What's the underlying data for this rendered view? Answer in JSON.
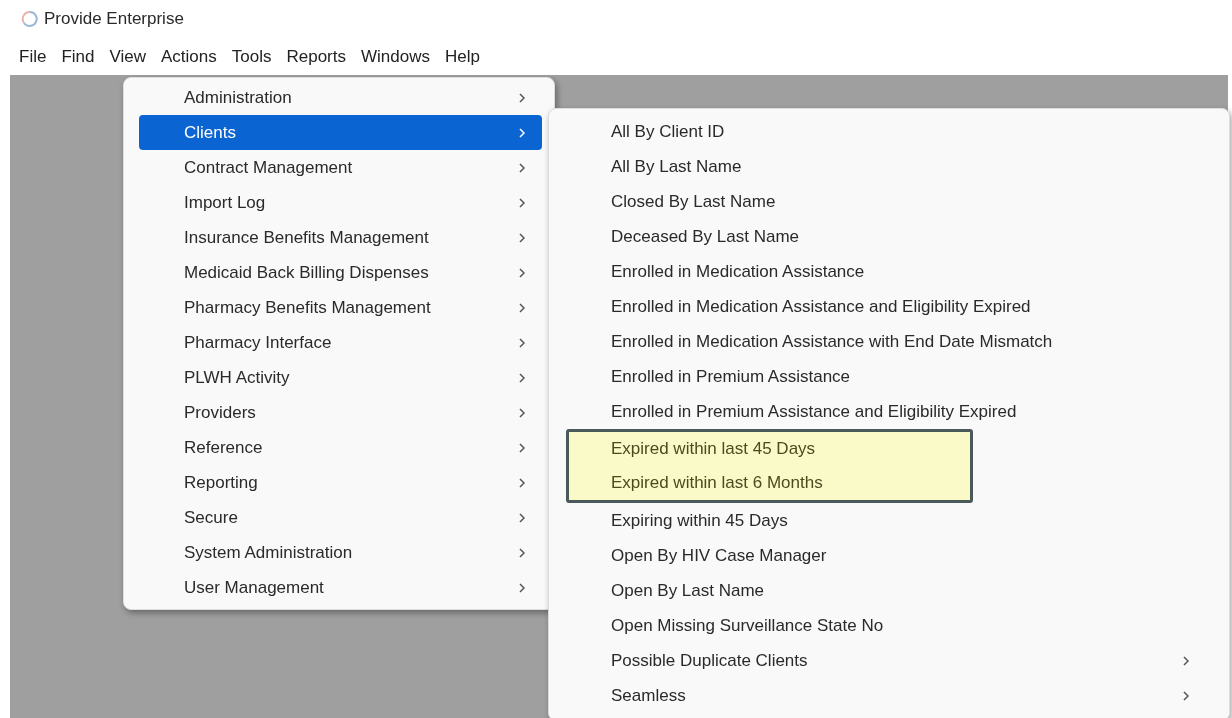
{
  "window": {
    "title": "Provide Enterprise"
  },
  "menubar": [
    {
      "label": "File"
    },
    {
      "label": "Find"
    },
    {
      "label": "View"
    },
    {
      "label": "Actions"
    },
    {
      "label": "Tools"
    },
    {
      "label": "Reports"
    },
    {
      "label": "Windows"
    },
    {
      "label": "Help"
    }
  ],
  "view_menu": [
    {
      "label": "Administration",
      "selected": false,
      "submenu": true
    },
    {
      "label": "Clients",
      "selected": true,
      "submenu": true
    },
    {
      "label": "Contract Management",
      "selected": false,
      "submenu": true
    },
    {
      "label": "Import Log",
      "selected": false,
      "submenu": true
    },
    {
      "label": "Insurance Benefits Management",
      "selected": false,
      "submenu": true
    },
    {
      "label": "Medicaid Back Billing Dispenses",
      "selected": false,
      "submenu": true
    },
    {
      "label": "Pharmacy Benefits Management",
      "selected": false,
      "submenu": true
    },
    {
      "label": "Pharmacy Interface",
      "selected": false,
      "submenu": true
    },
    {
      "label": "PLWH Activity",
      "selected": false,
      "submenu": true
    },
    {
      "label": "Providers",
      "selected": false,
      "submenu": true
    },
    {
      "label": "Reference",
      "selected": false,
      "submenu": true
    },
    {
      "label": "Reporting",
      "selected": false,
      "submenu": true
    },
    {
      "label": "Secure",
      "selected": false,
      "submenu": true
    },
    {
      "label": "System Administration",
      "selected": false,
      "submenu": true
    },
    {
      "label": "User Management",
      "selected": false,
      "submenu": true
    }
  ],
  "clients_menu": [
    {
      "label": "All By Client ID",
      "highlighted": false,
      "submenu": false
    },
    {
      "label": "All By Last Name",
      "highlighted": false,
      "submenu": false
    },
    {
      "label": "Closed By Last Name",
      "highlighted": false,
      "submenu": false
    },
    {
      "label": "Deceased By Last Name",
      "highlighted": false,
      "submenu": false
    },
    {
      "label": "Enrolled in Medication Assistance",
      "highlighted": false,
      "submenu": false
    },
    {
      "label": "Enrolled in Medication Assistance and Eligibility Expired",
      "highlighted": false,
      "submenu": false
    },
    {
      "label": "Enrolled in Medication Assistance with End Date Mismatch",
      "highlighted": false,
      "submenu": false
    },
    {
      "label": "Enrolled in Premium Assistance",
      "highlighted": false,
      "submenu": false
    },
    {
      "label": "Enrolled in Premium Assistance and Eligibility Expired",
      "highlighted": false,
      "submenu": false
    },
    {
      "label": "Expired within last 45 Days",
      "highlighted": true,
      "submenu": false
    },
    {
      "label": "Expired within last 6 Months",
      "highlighted": true,
      "submenu": false
    },
    {
      "label": "Expiring within 45 Days",
      "highlighted": false,
      "submenu": false
    },
    {
      "label": "Open By HIV Case Manager",
      "highlighted": false,
      "submenu": false
    },
    {
      "label": "Open By Last Name",
      "highlighted": false,
      "submenu": false
    },
    {
      "label": "Open Missing Surveillance State No",
      "highlighted": false,
      "submenu": false
    },
    {
      "label": "Possible Duplicate Clients",
      "highlighted": false,
      "submenu": true
    },
    {
      "label": "Seamless",
      "highlighted": false,
      "submenu": true
    }
  ]
}
